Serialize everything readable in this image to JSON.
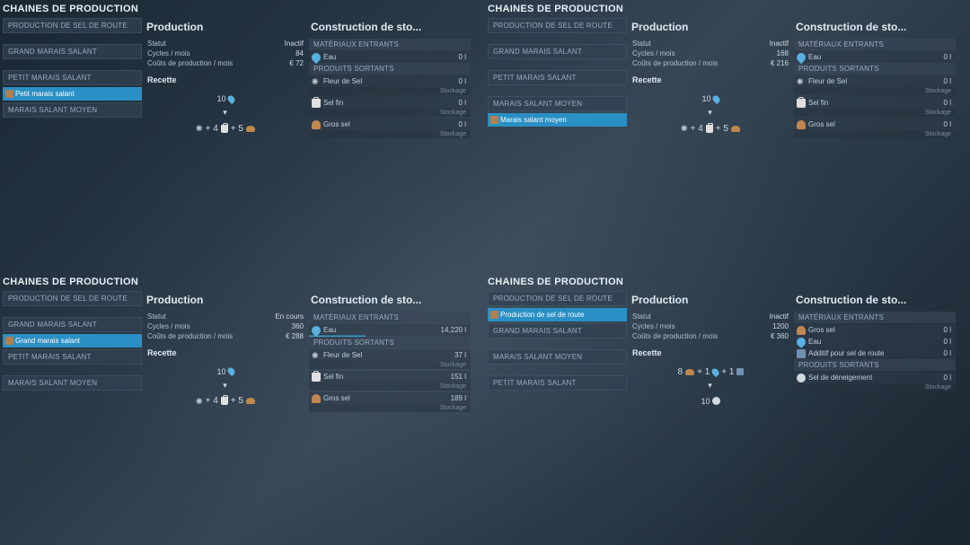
{
  "quadrants": [
    {
      "title": "CHAINES DE PRODUCTION",
      "sidebar": [
        {
          "type": "header",
          "label": "PRODUCTION DE SEL DE ROUTE"
        },
        {
          "type": "gap"
        },
        {
          "type": "header",
          "label": "GRAND MARAIS SALANT"
        },
        {
          "type": "gap"
        },
        {
          "type": "header",
          "label": "PETIT MARAIS SALANT"
        },
        {
          "type": "item",
          "label": "Petit marais salant",
          "selected": true,
          "icon": "box"
        },
        {
          "type": "header",
          "label": "MARAIS SALANT MOYEN"
        }
      ],
      "production": {
        "title": "Production",
        "stats": [
          {
            "label": "Statut",
            "value": "Inactif"
          },
          {
            "label": "Cycles / mois",
            "value": "84"
          },
          {
            "label": "Coûts de production / mois",
            "value": "€ 72"
          }
        ],
        "recipeTitle": "Recette",
        "recipeTop": {
          "qty": "10",
          "icon": "drop"
        },
        "recipeBottom": [
          {
            "icon": "flake",
            "text": "+ 4"
          },
          {
            "icon": "bag",
            "text": "+ 5"
          },
          {
            "icon": "pile",
            "text": ""
          }
        ]
      },
      "stock": {
        "title": "Construction de sto...",
        "in": {
          "header": "MATÉRIAUX ENTRANTS",
          "rows": [
            {
              "icon": "drop",
              "name": "Eau",
              "val": "0 l"
            }
          ]
        },
        "out": {
          "header": "PRODUITS SORTANTS",
          "rows": [
            {
              "icon": "flake",
              "name": "Fleur de Sel",
              "val": "0 l",
              "stock": "Stockage"
            },
            {
              "icon": "bag",
              "name": "Sel fin",
              "val": "0 l",
              "stock": "Stockage"
            },
            {
              "icon": "pile",
              "name": "Gros sel",
              "val": "0 l",
              "stock": "Stockage"
            }
          ]
        }
      }
    },
    {
      "title": "CHAINES DE PRODUCTION",
      "sidebar": [
        {
          "type": "header",
          "label": "PRODUCTION DE SEL DE ROUTE"
        },
        {
          "type": "gap"
        },
        {
          "type": "header",
          "label": "GRAND MARAIS SALANT"
        },
        {
          "type": "gap"
        },
        {
          "type": "header",
          "label": "PETIT MARAIS SALANT"
        },
        {
          "type": "gap"
        },
        {
          "type": "header",
          "label": "MARAIS SALANT MOYEN"
        },
        {
          "type": "item",
          "label": "Marais salant moyen",
          "selected": true,
          "icon": "box"
        }
      ],
      "production": {
        "title": "Production",
        "stats": [
          {
            "label": "Statut",
            "value": "Inactif"
          },
          {
            "label": "Cycles / mois",
            "value": "168"
          },
          {
            "label": "Coûts de production / mois",
            "value": "€ 216"
          }
        ],
        "recipeTitle": "Recette",
        "recipeTop": {
          "qty": "10",
          "icon": "drop"
        },
        "recipeBottom": [
          {
            "icon": "flake",
            "text": "+ 4"
          },
          {
            "icon": "bag",
            "text": "+ 5"
          },
          {
            "icon": "pile",
            "text": ""
          }
        ]
      },
      "stock": {
        "title": "Construction de sto...",
        "in": {
          "header": "MATÉRIAUX ENTRANTS",
          "rows": [
            {
              "icon": "drop",
              "name": "Eau",
              "val": "0 l"
            }
          ]
        },
        "out": {
          "header": "PRODUITS SORTANTS",
          "rows": [
            {
              "icon": "flake",
              "name": "Fleur de Sel",
              "val": "0 l",
              "stock": "Stockage"
            },
            {
              "icon": "bag",
              "name": "Sel fin",
              "val": "0 l",
              "stock": "Stockage"
            },
            {
              "icon": "pile",
              "name": "Gros sel",
              "val": "0 l",
              "stock": "Stockage"
            }
          ]
        }
      }
    },
    {
      "title": "CHAINES DE PRODUCTION",
      "sidebar": [
        {
          "type": "header",
          "label": "PRODUCTION DE SEL DE ROUTE"
        },
        {
          "type": "gap"
        },
        {
          "type": "header",
          "label": "GRAND MARAIS SALANT"
        },
        {
          "type": "item",
          "label": "Grand marais salant",
          "selected": true,
          "icon": "box"
        },
        {
          "type": "header",
          "label": "PETIT MARAIS SALANT"
        },
        {
          "type": "gap"
        },
        {
          "type": "header",
          "label": "MARAIS SALANT MOYEN"
        }
      ],
      "production": {
        "title": "Production",
        "stats": [
          {
            "label": "Statut",
            "value": "En cours"
          },
          {
            "label": "Cycles / mois",
            "value": "360"
          },
          {
            "label": "Coûts de production / mois",
            "value": "€ 288"
          }
        ],
        "recipeTitle": "Recette",
        "recipeTop": {
          "qty": "10",
          "icon": "drop"
        },
        "recipeBottom": [
          {
            "icon": "flake",
            "text": "+ 4"
          },
          {
            "icon": "bag",
            "text": "+ 5"
          },
          {
            "icon": "pile",
            "text": ""
          }
        ]
      },
      "stock": {
        "title": "Construction de sto...",
        "in": {
          "header": "MATÉRIAUX ENTRANTS",
          "rows": [
            {
              "icon": "drop",
              "name": "Eau",
              "val": "14,220 l",
              "bar": true
            }
          ]
        },
        "out": {
          "header": "PRODUITS SORTANTS",
          "rows": [
            {
              "icon": "flake",
              "name": "Fleur de Sel",
              "val": "37 l",
              "stock": "Stockage"
            },
            {
              "icon": "bag",
              "name": "Sel fin",
              "val": "151 l",
              "stock": "Stockage"
            },
            {
              "icon": "pile",
              "name": "Gros sel",
              "val": "189 l",
              "stock": "Stockage"
            }
          ]
        }
      }
    },
    {
      "title": "CHAINES DE PRODUCTION",
      "sidebar": [
        {
          "type": "header",
          "label": "PRODUCTION DE SEL DE ROUTE"
        },
        {
          "type": "item",
          "label": "Production de sel de route",
          "selected": true,
          "icon": "box"
        },
        {
          "type": "header",
          "label": "GRAND MARAIS SALANT"
        },
        {
          "type": "gap"
        },
        {
          "type": "header",
          "label": "MARAIS SALANT MOYEN"
        },
        {
          "type": "gap"
        },
        {
          "type": "header",
          "label": "PETIT MARAIS SALANT"
        }
      ],
      "production": {
        "title": "Production",
        "stats": [
          {
            "label": "Statut",
            "value": "Inactif"
          },
          {
            "label": "Cycles / mois",
            "value": "1200"
          },
          {
            "label": "Coûts de production / mois",
            "value": "€ 360"
          }
        ],
        "recipeTitle": "Recette",
        "recipeTopRoute": [
          {
            "text": "8",
            "icon": "pile"
          },
          {
            "text": "+ 1",
            "icon": "drop"
          },
          {
            "text": "+ 1",
            "icon": "add"
          }
        ],
        "recipeBottomRoute": {
          "qty": "10",
          "icon": "snow"
        }
      },
      "stock": {
        "title": "Construction de sto...",
        "in": {
          "header": "MATÉRIAUX ENTRANTS",
          "rows": [
            {
              "icon": "pile",
              "name": "Gros sel",
              "val": "0 l"
            },
            {
              "icon": "drop",
              "name": "Eau",
              "val": "0 l"
            },
            {
              "icon": "add",
              "name": "Additif pour sel de route",
              "val": "0 l"
            }
          ]
        },
        "out": {
          "header": "PRODUITS SORTANTS",
          "rows": [
            {
              "icon": "snow",
              "name": "Sel de déneigement",
              "val": "0 l",
              "stock": "Stockage"
            }
          ]
        }
      }
    }
  ]
}
